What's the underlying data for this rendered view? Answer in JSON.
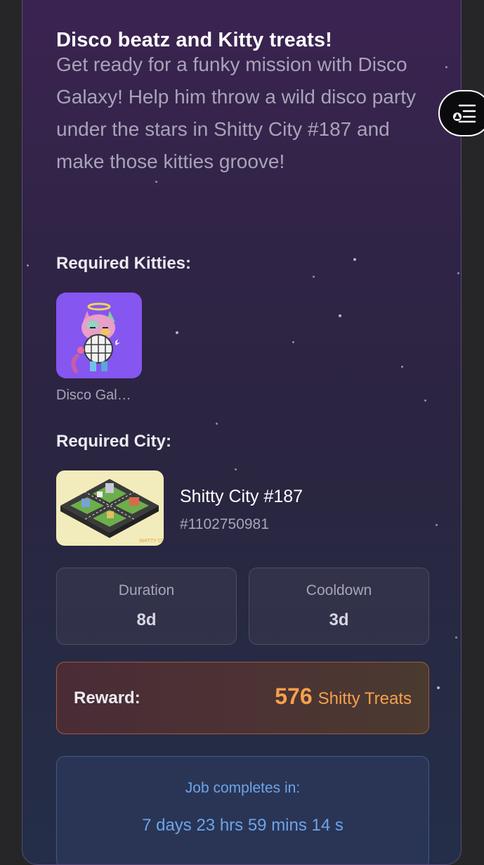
{
  "mission": {
    "title": "Disco beatz and Kitty treats!",
    "description": "Get ready for a funky mission with Disco Galaxy! Help him throw a wild disco party under the stars in Shitty City #187 and make those kitties groove!"
  },
  "required_kitties": {
    "label": "Required Kitties:",
    "items": [
      {
        "name": "Disco Gal…",
        "image_alt": "disco-galaxy-kitty"
      }
    ]
  },
  "required_city": {
    "label": "Required City:",
    "name": "Shitty City #187",
    "id": "#1102750981",
    "image_alt": "shitty-city-isometric-map"
  },
  "stats": {
    "duration": {
      "label": "Duration",
      "value": "8d"
    },
    "cooldown": {
      "label": "Cooldown",
      "value": "3d"
    }
  },
  "reward": {
    "label": "Reward:",
    "amount": "576",
    "unit": "Shitty Treats",
    "accent_color": "#f6a04d"
  },
  "timer": {
    "label": "Job completes in:",
    "value": "7 days 23 hrs 59 mins 14 s",
    "accent_color": "#6ea4e6"
  },
  "floating_button": {
    "icon": "menu-filter-icon"
  }
}
